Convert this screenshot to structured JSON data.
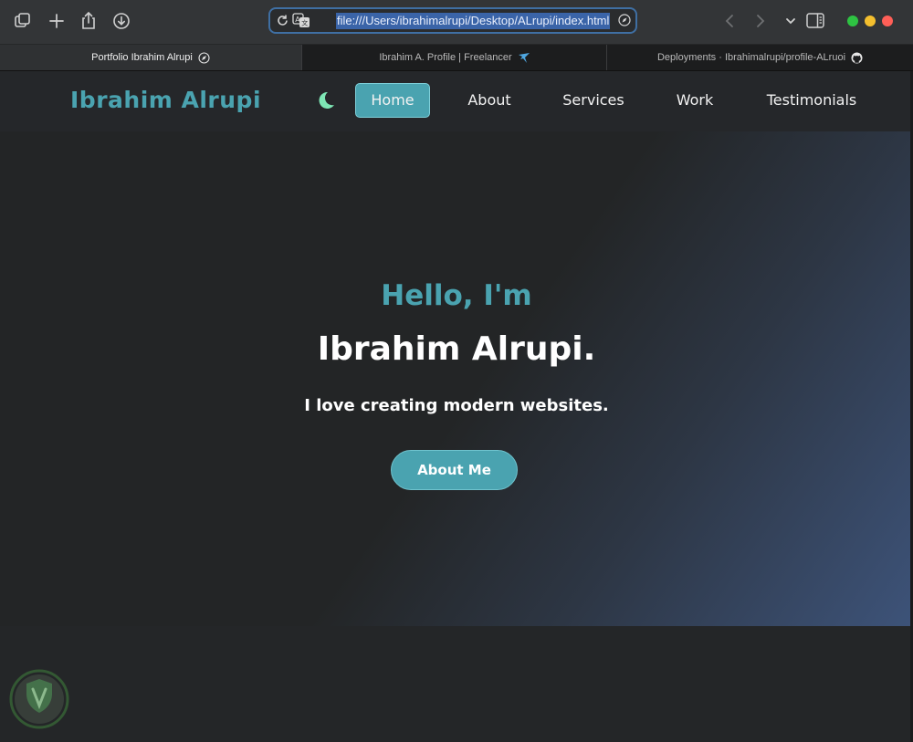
{
  "browser": {
    "url": "file:///Users/ibrahimalrupi/Desktop/ALrupi/index.html",
    "tabs": [
      {
        "label": "Portfolio Ibrahim Alrupi",
        "icon": "compass-icon",
        "active": true
      },
      {
        "label": "Ibrahim A. Profile | Freelancer",
        "icon": "freelancer-bird-icon",
        "active": false
      },
      {
        "label": "Deployments · Ibrahimalrupi/profile-ALruoi",
        "icon": "github-icon",
        "active": false
      }
    ],
    "traffic_colors": {
      "green": "#2ec342",
      "yellow": "#f4bf2e",
      "red": "#ff5f57"
    }
  },
  "site": {
    "logo": "Ibrahim Alrupi",
    "theme_icon": "moon-icon",
    "nav": [
      {
        "label": "Home",
        "active": true
      },
      {
        "label": "About",
        "active": false
      },
      {
        "label": "Services",
        "active": false
      },
      {
        "label": "Work",
        "active": false
      },
      {
        "label": "Testimonials",
        "active": false
      }
    ]
  },
  "hero": {
    "greeting": "Hello, I'm",
    "name": "Ibrahim Alrupi.",
    "tagline": "I love creating modern websites.",
    "cta": "About Me"
  },
  "colors": {
    "accent": "#4aa3b0",
    "moon": "#7ee6b5",
    "background": "#232526"
  }
}
